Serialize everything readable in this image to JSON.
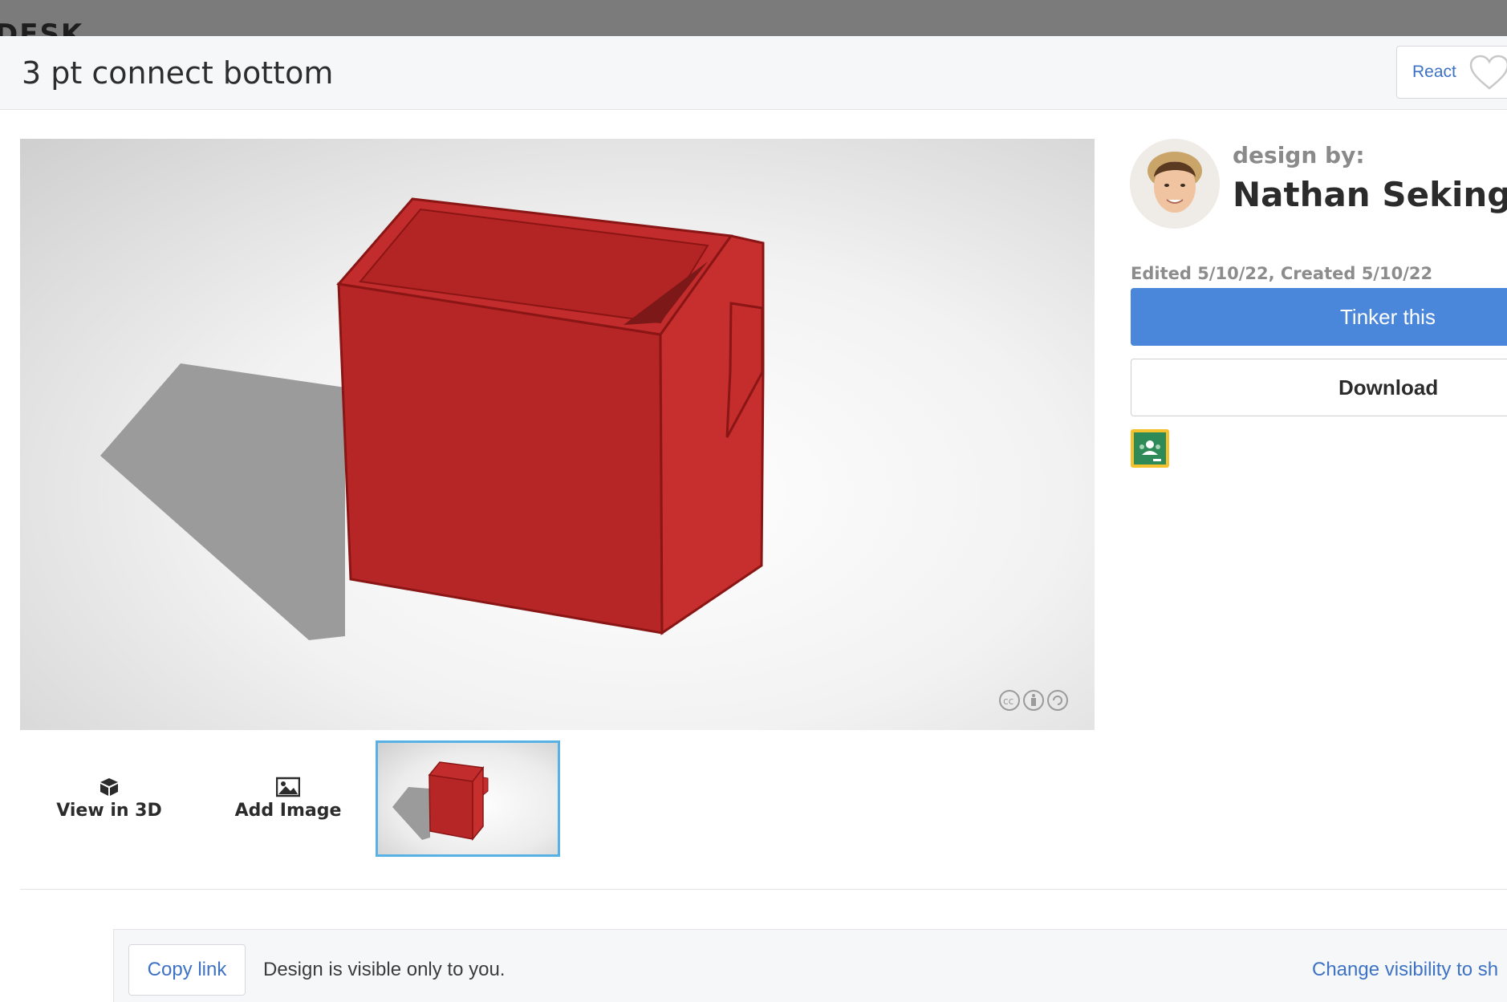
{
  "app": {
    "brand_fragment": "DESK"
  },
  "design": {
    "title": "3 pt connect bottom",
    "react_label": "React",
    "designer_caption": "design by:",
    "designer_name": "Nathan Sekinger",
    "dates": "Edited 5/10/22, Created 5/10/22"
  },
  "actions": {
    "tinker_label": "Tinker this",
    "download_label": "Download",
    "classroom_icon": "google-classroom-icon"
  },
  "viewer_tools": [
    {
      "label": "View in 3D",
      "icon": "cube-icon"
    },
    {
      "label": "Add Image",
      "icon": "image-icon"
    }
  ],
  "share": {
    "copy_label": "Copy link",
    "visibility_text": "Design is visible only to you.",
    "change_visibility_label": "Change visibility to sh"
  },
  "colors": {
    "accent": "#4a86d9",
    "link": "#3d72c4",
    "model_red": "#c72a2a",
    "thumbnail_border": "#58b1e4"
  },
  "license_icons": [
    "cc-icon",
    "attribution-icon",
    "share-alike-icon"
  ]
}
